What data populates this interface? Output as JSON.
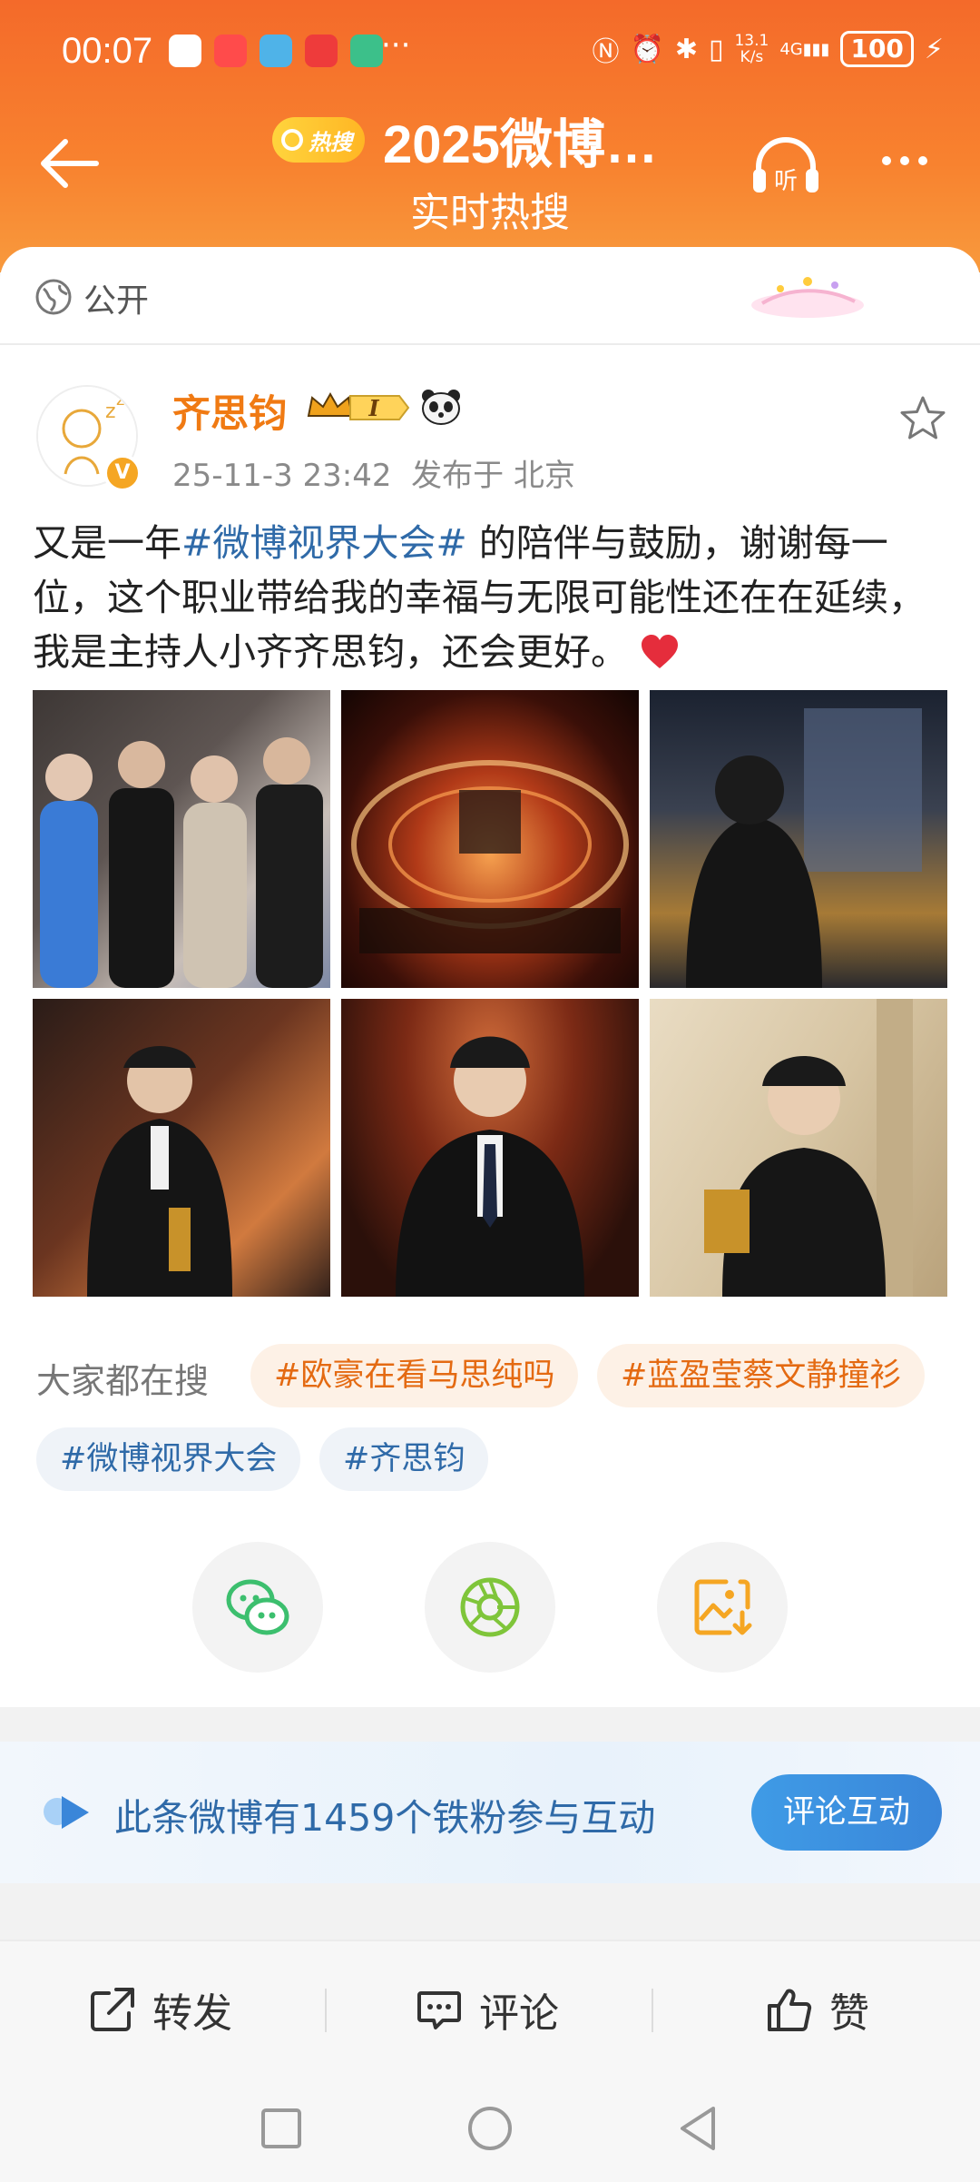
{
  "status_bar": {
    "time": "00:07",
    "network_speed_top": "13.1",
    "network_speed_unit": "K/s",
    "signal": "4G",
    "battery": "100"
  },
  "header": {
    "hot_badge": "热搜",
    "title": "2025微博…",
    "subtitle": "实时热搜",
    "listen_label": "听"
  },
  "visibility": {
    "label": "公开"
  },
  "post": {
    "author": "齐思钧",
    "member_level": "I",
    "verified_mark": "V",
    "timestamp": "25-11-3 23:42",
    "location": "发布于 北京",
    "text_prefix": "又是一年",
    "hashtag": "#微博视界大会#",
    "text_suffix": " 的陪伴与鼓励，谢谢每一位，这个职业带给我的幸福与无限可能性还在在延续，我是主持人小齐齐思钧，还会更好。",
    "photo_count": 6
  },
  "hot_search": {
    "label": "大家都在搜",
    "chips": [
      "#欧豪在看马思纯吗",
      "#蓝盈莹蔡文静撞衫",
      "#微博视界大会",
      "#齐思钧"
    ]
  },
  "interaction": {
    "text": "此条微博有1459个铁粉参与互动",
    "button": "评论互动"
  },
  "actions": {
    "repost": "转发",
    "comment": "评论",
    "like": "赞"
  },
  "colors": {
    "header_orange": "#f46a2a",
    "author_orange": "#f07a13",
    "link_blue": "#2f6aa8",
    "button_blue": "#3a86d9"
  }
}
